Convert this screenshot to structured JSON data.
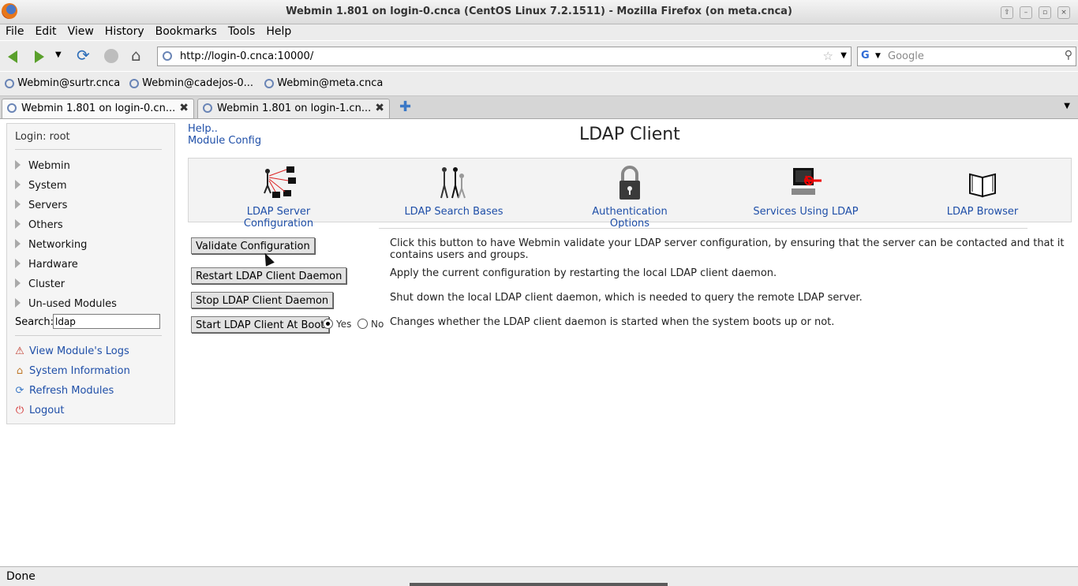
{
  "window": {
    "title": "Webmin 1.801 on login-0.cnca (CentOS Linux 7.2.1511) - Mozilla Firefox (on meta.cnca)"
  },
  "menubar": {
    "items": [
      "File",
      "Edit",
      "View",
      "History",
      "Bookmarks",
      "Tools",
      "Help"
    ]
  },
  "navbar": {
    "url": "http://login-0.cnca:10000/",
    "search_placeholder": "Google"
  },
  "bookmarks": [
    "Webmin@surtr.cnca",
    "Webmin@cadejos-0...",
    "Webmin@meta.cnca"
  ],
  "tabs": [
    {
      "label": "Webmin 1.801 on login-0.cn..."
    },
    {
      "label": "Webmin 1.801 on login-1.cn..."
    }
  ],
  "sidebar": {
    "login": "Login: root",
    "categories": [
      "Webmin",
      "System",
      "Servers",
      "Others",
      "Networking",
      "Hardware",
      "Cluster",
      "Un-used Modules"
    ],
    "search_label": "Search:",
    "search_value": "ldap",
    "links": [
      "View Module's Logs",
      "System Information",
      "Refresh Modules",
      "Logout"
    ]
  },
  "page": {
    "help": "Help..",
    "module_config": "Module Config",
    "title": "LDAP Client",
    "icons": [
      "LDAP Server Configuration",
      "LDAP Search Bases",
      "Authentication Options",
      "Services Using LDAP",
      "LDAP Browser"
    ],
    "actions": [
      {
        "button": "Validate Configuration",
        "desc": "Click this button to have Webmin validate your LDAP server configuration, by ensuring that the server can be contacted and that it contains users and groups."
      },
      {
        "button": "Restart LDAP Client Daemon",
        "desc": "Apply the current configuration by restarting the local LDAP client daemon."
      },
      {
        "button": "Stop LDAP Client Daemon",
        "desc": "Shut down the local LDAP client daemon, which is needed to query the remote LDAP server."
      },
      {
        "button": "Start LDAP Client At Boot",
        "desc": "Changes whether the LDAP client daemon is started when the system boots up or not."
      }
    ],
    "boot_yes": "Yes",
    "boot_no": "No",
    "boot_selected": "Yes"
  },
  "status": {
    "text": "Done"
  }
}
